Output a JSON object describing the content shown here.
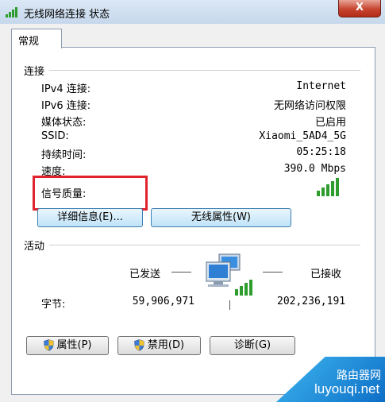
{
  "window": {
    "title": "无线网络连接 状态",
    "close_label": "X"
  },
  "tab": {
    "label": "常规"
  },
  "connection": {
    "section_title": "连接",
    "rows": [
      {
        "label": "IPv4 连接:",
        "value": "Internet"
      },
      {
        "label": "IPv6 连接:",
        "value": "无网络访问权限"
      },
      {
        "label": "媒体状态:",
        "value": "已启用"
      },
      {
        "label": "SSID:",
        "value": "Xiaomi_5AD4_5G"
      },
      {
        "label": "持续时间:",
        "value": "05:25:18"
      },
      {
        "label": "速度:",
        "value": "390.0 Mbps"
      }
    ],
    "signal_label": "信号质量:",
    "signal_bars": 5,
    "details_button": "详细信息(E)...",
    "wireless_props_button": "无线属性(W)"
  },
  "activity": {
    "section_title": "活动",
    "sent_label": "已发送",
    "received_label": "已接收",
    "bytes_label": "字节:",
    "bytes_sent": "59,906,971",
    "bytes_received": "202,236,191"
  },
  "buttons": {
    "properties": "属性(P)",
    "disable": "禁用(D)",
    "diagnose": "诊断(G)"
  },
  "watermark": {
    "line1": "路由器网",
    "line2": "luyouqi.net"
  },
  "colors": {
    "highlight": "#e0242e",
    "accent": "#3c7fb1",
    "signal": "#2e9d2e"
  }
}
